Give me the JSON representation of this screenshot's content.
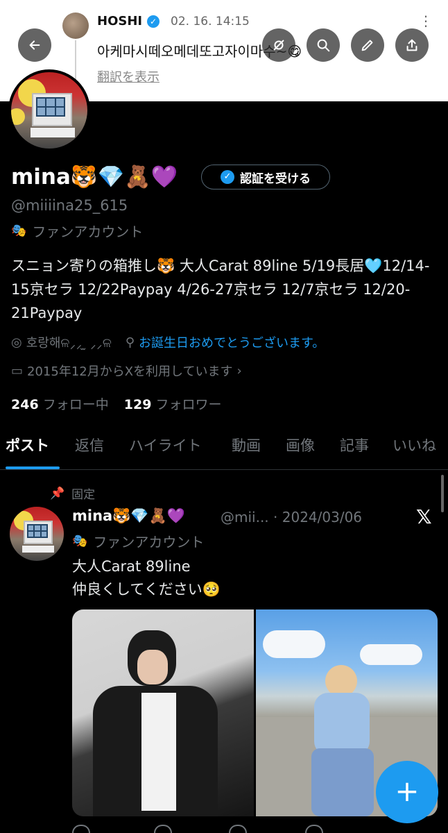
{
  "overlay_tweet": {
    "user_name": "HOSHI",
    "date": "02. 16. 14:15",
    "text": "아케마시떼오메데또고자이마수~😋",
    "translate_label": "翻訳を表示"
  },
  "header_buttons": [
    "back-icon",
    "grok-icon",
    "search-icon",
    "edit-icon",
    "share-icon"
  ],
  "profile": {
    "name": "mina🐯💎🧸💜",
    "verify_button": "認証を受ける",
    "handle": "@miiiina25_615",
    "label": "ファンアカウント",
    "bio": "スニョン寄りの箱推し🐯 大人Carat 89line 5/19長居🩵12/14-15京セラ 12/22Paypay 4/26-27京セラ 12/7京セラ 12/20-21Paypay",
    "location": "호랑해ଳ⸝⸝ ̫ ⸝⸝ଳ",
    "birthday": "お誕生日おめでとうございます。",
    "joined": "2015年12月からXを利用しています",
    "following_count": "246",
    "following_label": "フォロー中",
    "followers_count": "129",
    "followers_label": "フォロワー"
  },
  "tabs": [
    "ポスト",
    "返信",
    "ハイライト",
    "動画",
    "画像",
    "記事",
    "いいね"
  ],
  "active_tab": "ポスト",
  "post": {
    "pinned_label": "固定",
    "name": "mina🐯💎🧸💜",
    "handle_date": "@mii... · 2024/03/06",
    "label": "ファンアカウント",
    "line1": "大人Carat 89line",
    "line2": "仲良くしてください🥺"
  },
  "fab_label": "+",
  "colors": {
    "accent": "#1d9bf0",
    "background": "#000000",
    "text": "#e7e9ea",
    "muted": "#71767b"
  }
}
